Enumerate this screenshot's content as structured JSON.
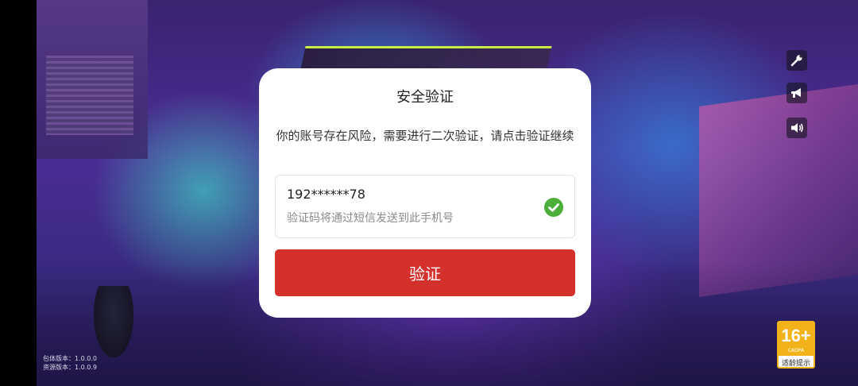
{
  "dialog": {
    "title": "安全验证",
    "message": "你的账号存在风险，需要进行二次验证，请点击验证继续",
    "phone_number": "192******78",
    "phone_hint": "验证码将通过短信发送到此手机号",
    "verify_label": "验证",
    "verify_color": "#d4312c",
    "check_color": "#4caf3a"
  },
  "side_tools": [
    "wrench-icon",
    "megaphone-icon",
    "speaker-icon"
  ],
  "version": {
    "package": "包体版本：1.0.0.0",
    "resource": "资源版本：1.0.0.9"
  },
  "age_rating": {
    "rating": "16+",
    "org": "CADPA",
    "label": "适龄提示",
    "color": "#f2b21a"
  }
}
